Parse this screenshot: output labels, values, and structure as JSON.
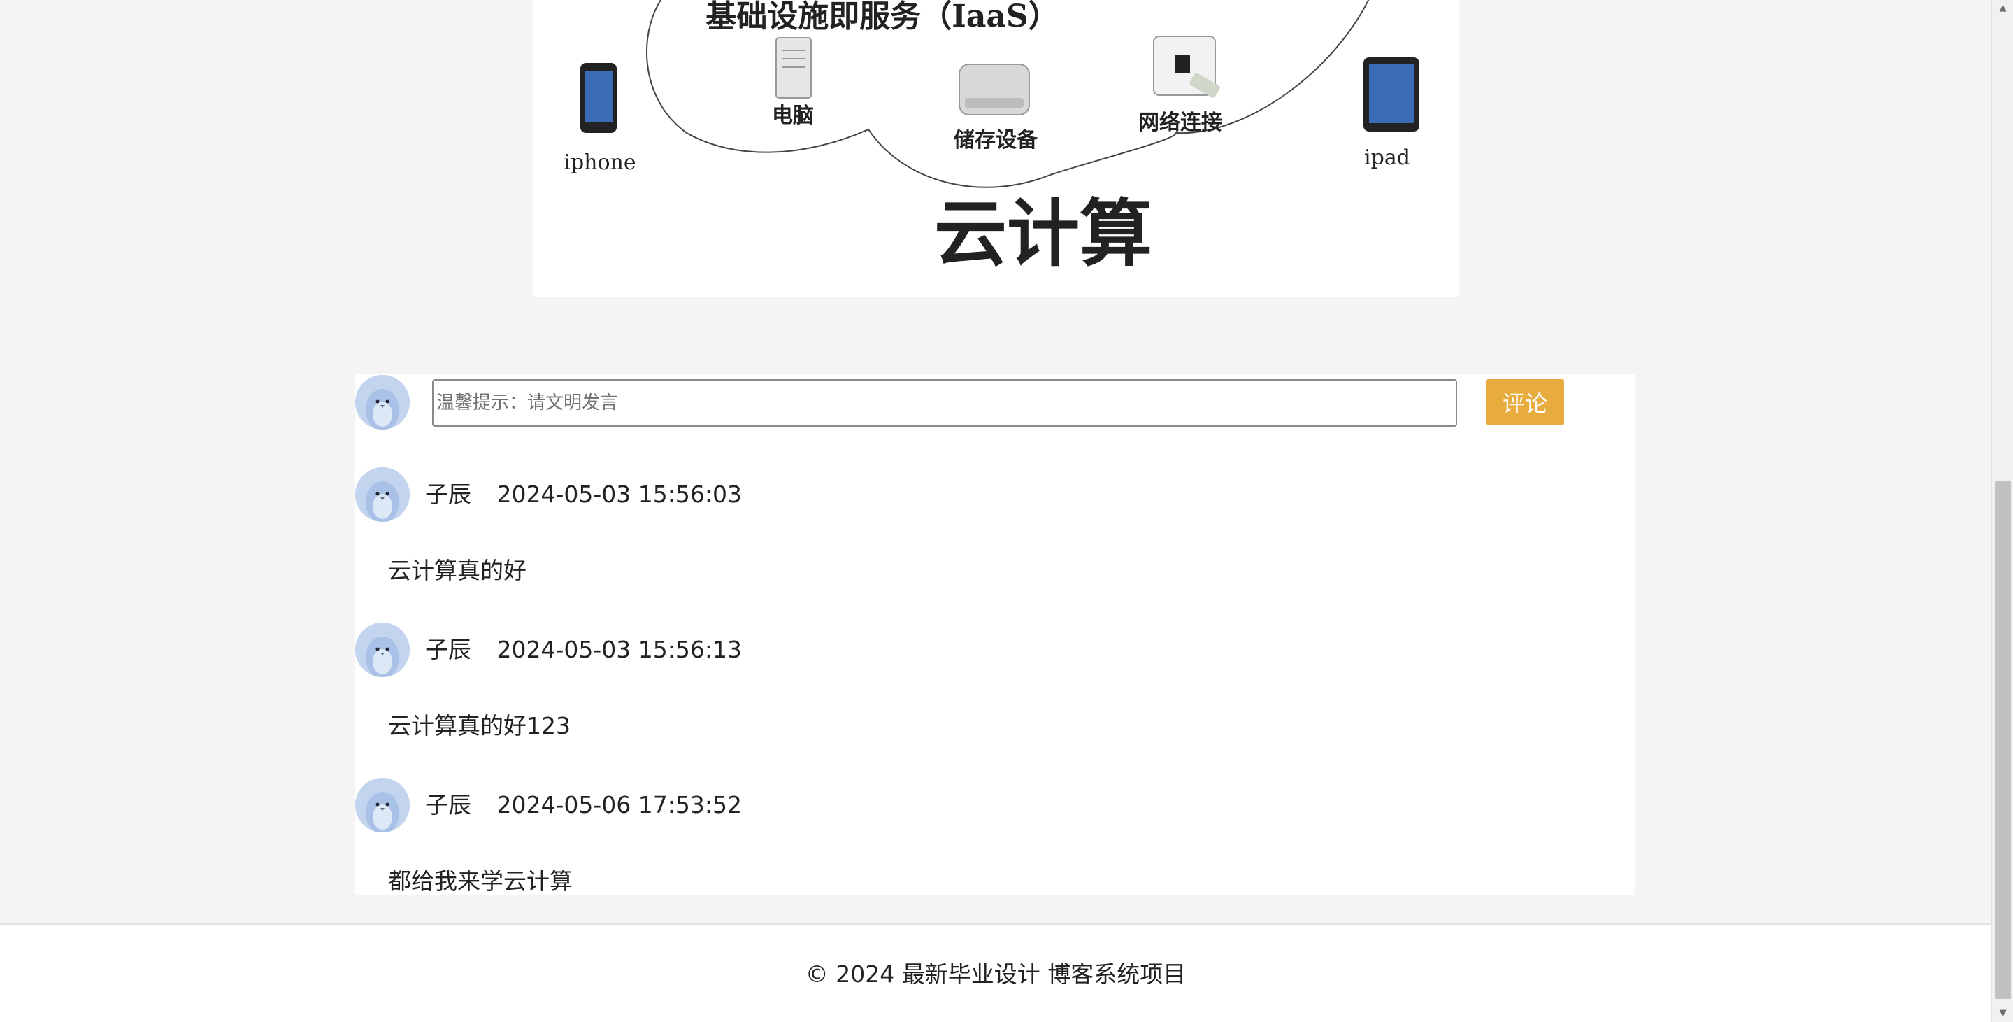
{
  "figure": {
    "cloud_label": "基础设施即服务（IaaS）",
    "main_caption": "云计算",
    "devices": {
      "phone": "iphone",
      "tablet": "ipad",
      "server": "电脑",
      "storage": "储存设备",
      "network": "网络连接"
    }
  },
  "compose": {
    "placeholder": "温馨提示：请文明发言",
    "value": "",
    "submit_label": "评论"
  },
  "comments": [
    {
      "author": "子辰",
      "time": "2024-05-03 15:56:03",
      "content": "云计算真的好"
    },
    {
      "author": "子辰",
      "time": "2024-05-03 15:56:13",
      "content": "云计算真的好123"
    },
    {
      "author": "子辰",
      "time": "2024-05-06 17:53:52",
      "content": "都给我来学云计算"
    }
  ],
  "footer": {
    "copyright": "© 2024 最新毕业设计 博客系统项目"
  },
  "colors": {
    "accent_button": "#e8ac3e",
    "avatar_bg": "#c3d5ee",
    "page_bg": "#f4f4f4"
  },
  "icons": {
    "avatar": "penguin-avatar-icon",
    "scroll_up": "chevron-up-icon",
    "scroll_down": "chevron-down-icon"
  }
}
